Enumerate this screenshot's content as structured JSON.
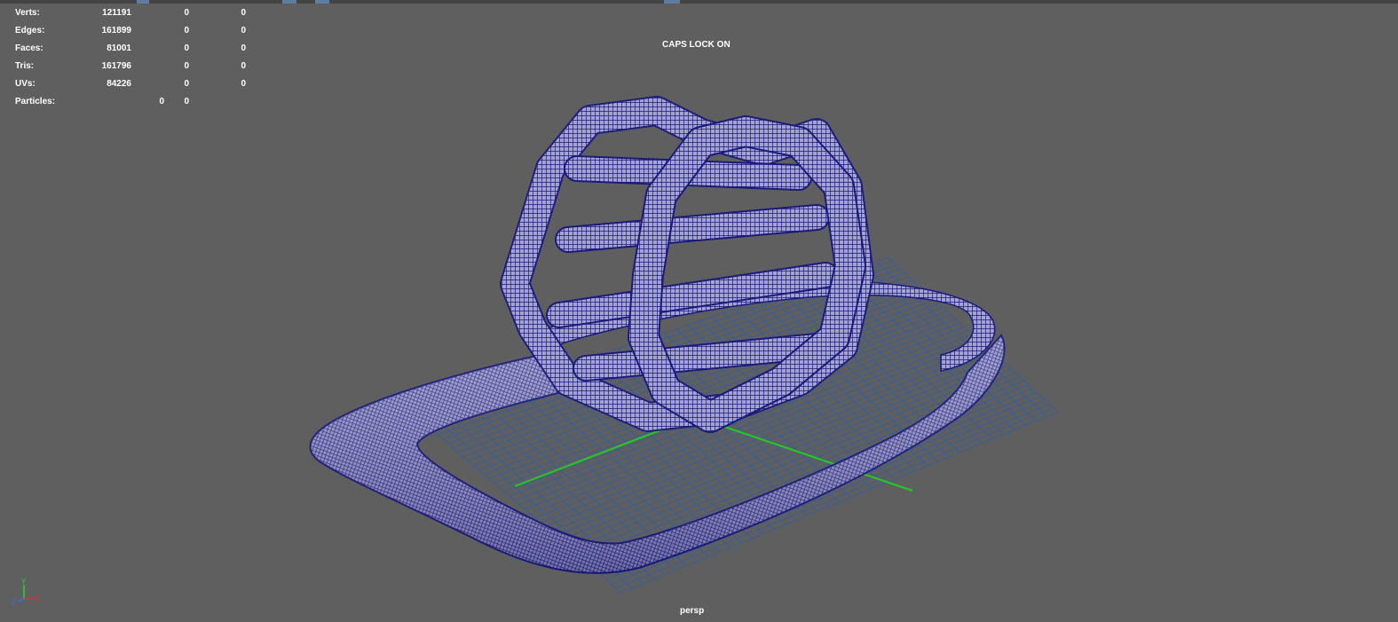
{
  "hud": {
    "rows": [
      {
        "label": "Verts:",
        "c1": "121191",
        "c2": "0",
        "c3": "0"
      },
      {
        "label": "Edges:",
        "c1": "161899",
        "c2": "0",
        "c3": "0"
      },
      {
        "label": "Faces:",
        "c1": "81001",
        "c2": "0",
        "c3": "0"
      },
      {
        "label": "Tris:",
        "c1": "161796",
        "c2": "0",
        "c3": "0"
      },
      {
        "label": "UVs:",
        "c1": "84226",
        "c2": "0",
        "c3": "0"
      },
      {
        "label": "Particles:",
        "c1": "0",
        "c2": "0"
      }
    ]
  },
  "caps_lock": "CAPS LOCK ON",
  "camera": "persp",
  "axis_gizmo": {
    "y": "Y",
    "x": "X",
    "z": "Z"
  },
  "colors": {
    "background": "#5f5f5f",
    "wireframe": "#1b1a7a",
    "mesh_fill": "#9c9ccf",
    "grid": "#2f5fa0",
    "grid_axis": "#22cc22",
    "text": "#ffffff"
  }
}
